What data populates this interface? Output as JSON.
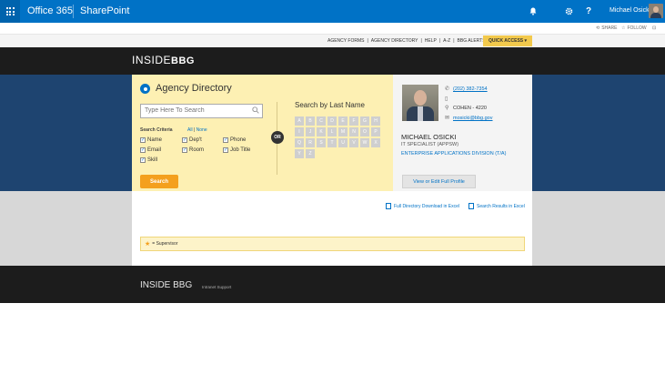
{
  "suitebar": {
    "brand": "Office 365",
    "app": "SharePoint",
    "user_name": "Michael Osicki",
    "bell_icon": "bell-icon",
    "gear_icon": "gear-icon",
    "help_icon": "?"
  },
  "subbar": {
    "share": "SHARE",
    "follow": "FOLLOW"
  },
  "topnav": {
    "items": [
      "AGENCY FORMS",
      "|",
      "AGENCY DIRECTORY",
      "|",
      "HELP",
      "|",
      "A-Z",
      "|",
      "BBG ALERTS"
    ],
    "quick_access": "QUICK ACCESS ▾"
  },
  "header": {
    "logo_inside": "INSIDE",
    "logo_bbg": "BBG"
  },
  "directory": {
    "title": "Agency Directory",
    "search_placeholder": "Type Here To Search",
    "criteria_title": "Search Criteria",
    "criteria_all": "All",
    "criteria_sep": "|",
    "criteria_none": "None",
    "criteria": [
      {
        "label": "Name",
        "checked": true
      },
      {
        "label": "Dep't",
        "checked": true
      },
      {
        "label": "Phone",
        "checked": true
      },
      {
        "label": "Email",
        "checked": true
      },
      {
        "label": "Room",
        "checked": true
      },
      {
        "label": "Job Title",
        "checked": true
      },
      {
        "label": "Skill",
        "checked": true
      }
    ],
    "search_button": "Search",
    "or_label": "OR",
    "last_name_title": "Search by Last Name",
    "letters": [
      "A",
      "B",
      "C",
      "D",
      "E",
      "F",
      "G",
      "H",
      "I",
      "J",
      "K",
      "L",
      "M",
      "N",
      "O",
      "P",
      "Q",
      "R",
      "S",
      "T",
      "U",
      "V",
      "W",
      "X",
      "Y",
      "Z"
    ]
  },
  "profile": {
    "phone": "(202) 382-7354",
    "mobile": "",
    "room": "COHEN - 4220",
    "email": "mosicki@bbg.gov",
    "name": "MICHAEL OSICKI",
    "job_title": "IT SPECIALIST (APPSW)",
    "division": "ENTERPRISE APPLICATIONS DIVISION (T/A)",
    "edit_button": "View or Edit Full Profile"
  },
  "downloads": {
    "full_directory": "Full Directory Download in Excel",
    "search_results": "Search Results in Excel"
  },
  "legend": {
    "text": "= Supervisor"
  },
  "footer": {
    "title": "INSIDE BBG",
    "link": "Intranet Support"
  }
}
